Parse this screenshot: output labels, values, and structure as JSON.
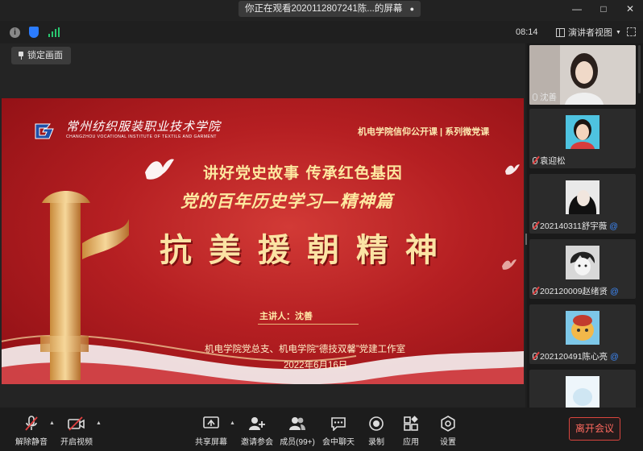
{
  "window": {
    "sharing_label": "你正在观看2020112807241陈...的屏幕",
    "pin_icon": "pin-icon",
    "controls": [
      "minimize-icon",
      "maximize-icon",
      "close-icon"
    ]
  },
  "infobar": {
    "time": "08:14",
    "view_mode": "演讲者视图",
    "icons": [
      "info-icon",
      "shield-icon",
      "signal-icon",
      "fullscreen-icon"
    ]
  },
  "main": {
    "lock_button": "锁定画面"
  },
  "slide": {
    "school_name_cn": "常州纺织服装职业技术学院",
    "school_name_en": "CHANGZHOU VOCATIONAL INSTITUTE OF TEXTILE AND GARMENT",
    "course": "机电学院信仰公开课 | 系列微党课",
    "slogan1": "讲好党史故事  传承红色基因",
    "slogan2": "党的百年历史学习—精神篇",
    "title": "抗美援朝精神",
    "speaker": "主讲人：沈善",
    "organizer": "机电学院党总支、机电学院“德技双馨”党建工作室",
    "date": "2022年6月16日"
  },
  "participants": [
    {
      "name": "沈善",
      "mic": "on",
      "photo": "video"
    },
    {
      "name": "袁迎松",
      "mic": "off",
      "photo": "avatar"
    },
    {
      "name": "202140311舒宇薇",
      "mic": "off",
      "photo": "avatar",
      "suffix": "@"
    },
    {
      "name": "202120009赵绪贤",
      "mic": "off",
      "photo": "avatar",
      "suffix": "@"
    },
    {
      "name": "202120491陈心亮",
      "mic": "off",
      "photo": "avatar",
      "suffix": "@"
    }
  ],
  "toolbar": {
    "mute": "解除静音",
    "video": "开启视频",
    "share": "共享屏幕",
    "invite": "邀请参会",
    "members": "成员(99+)",
    "chat": "会中聊天",
    "record": "录制",
    "apps": "应用",
    "settings": "设置",
    "leave": "离开会议"
  },
  "colors": {
    "slide_red": "#b51f22",
    "gold_text": "#fde8a0",
    "leave_red": "#d9453e",
    "signal_green": "#29c76f",
    "shield_blue": "#2b7cff"
  }
}
